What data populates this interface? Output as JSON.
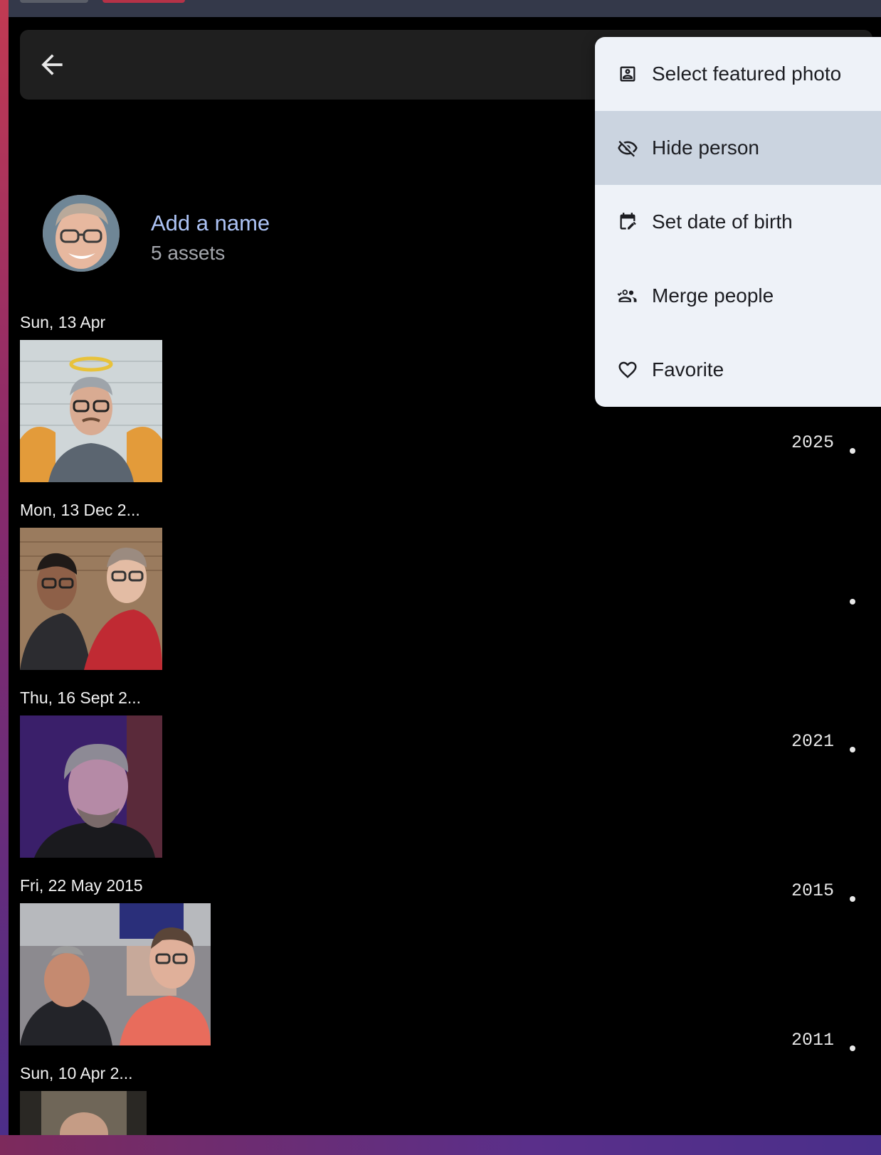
{
  "toolbar": {
    "back_label": "Back"
  },
  "person": {
    "name_placeholder": "Add a name",
    "asset_count": "5 assets"
  },
  "groups": [
    {
      "date": "Sun, 13 Apr"
    },
    {
      "date": "Mon, 13 Dec 2..."
    },
    {
      "date": "Thu, 16 Sept 2..."
    },
    {
      "date": "Fri, 22 May 2015"
    },
    {
      "date": "Sun, 10 Apr 2..."
    }
  ],
  "timeline": {
    "years": [
      "2025",
      "2021",
      "2015",
      "2011"
    ]
  },
  "menu": {
    "items": [
      {
        "label": "Select featured photo",
        "icon": "portrait-icon"
      },
      {
        "label": "Hide person",
        "icon": "eye-off-icon",
        "highlighted": true
      },
      {
        "label": "Set date of birth",
        "icon": "calendar-edit-icon"
      },
      {
        "label": "Merge people",
        "icon": "account-merge-icon"
      },
      {
        "label": "Favorite",
        "icon": "heart-outline-icon"
      }
    ]
  },
  "colors": {
    "app_background": "#000000",
    "toolbar_background": "#1f1f1f",
    "name_link": "#adc3f5",
    "menu_background": "#eef2f8",
    "menu_highlight": "#cbd4e0"
  }
}
